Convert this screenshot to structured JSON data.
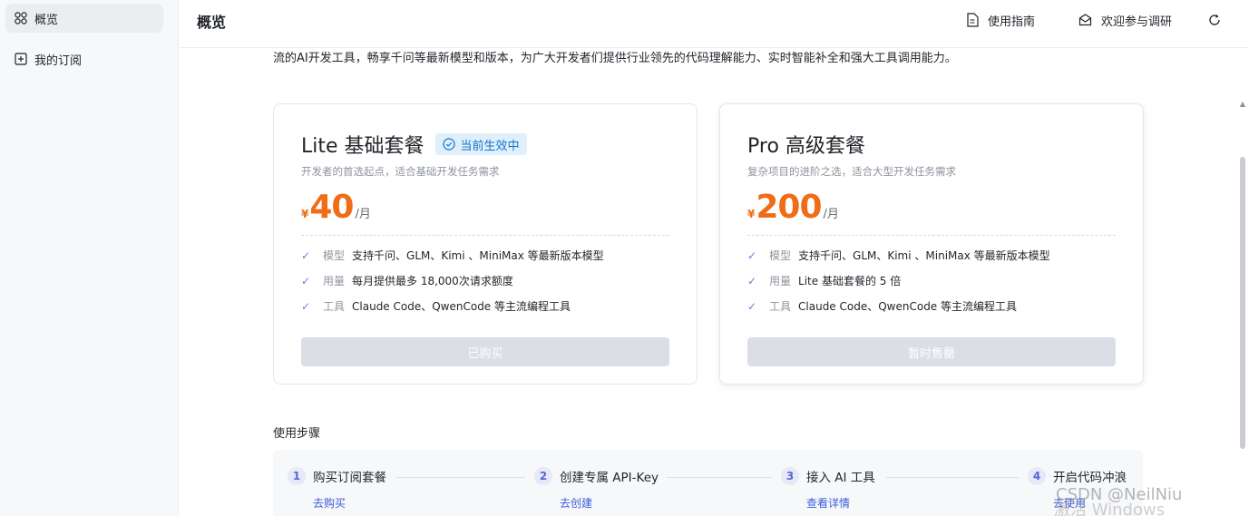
{
  "sidebar": {
    "items": [
      {
        "label": "概览",
        "icon": "grid-icon",
        "active": true
      },
      {
        "label": "我的订阅",
        "icon": "plus-square-icon",
        "active": false
      }
    ]
  },
  "header": {
    "title": "概览",
    "guide_label": "使用指南",
    "survey_label": "欢迎参与调研",
    "refresh_icon": "refresh-icon"
  },
  "intro": "流的AI开发工具，畅享千问等最新模型和版本，为广大开发者们提供行业领先的代码理解能力、实时智能补全和强大工具调用能力。",
  "plans": [
    {
      "title": "Lite 基础套餐",
      "badge": "当前生效中",
      "subtitle": "开发者的首选起点，适合基础开发任务需求",
      "currency": "¥",
      "price": "40",
      "unit": "/月",
      "features": [
        {
          "key": "模型",
          "value": "支持千问、GLM、Kimi 、MiniMax 等最新版本模型"
        },
        {
          "key": "用量",
          "value": "每月提供最多 18,000次请求额度"
        },
        {
          "key": "工具",
          "value": "Claude Code、QwenCode 等主流编程工具"
        }
      ],
      "button": "已购买"
    },
    {
      "title": "Pro 高级套餐",
      "badge": "",
      "subtitle": "复杂项目的进阶之选，适合大型开发任务需求",
      "currency": "¥",
      "price": "200",
      "unit": "/月",
      "features": [
        {
          "key": "模型",
          "value": "支持千问、GLM、Kimi 、MiniMax 等最新版本模型"
        },
        {
          "key": "用量",
          "value": "Lite 基础套餐的 5 倍"
        },
        {
          "key": "工具",
          "value": "Claude Code、QwenCode 等主流编程工具"
        }
      ],
      "button": "暂时售罄"
    }
  ],
  "steps": {
    "title": "使用步骤",
    "items": [
      {
        "num": "1",
        "label": "购买订阅套餐",
        "link": "去购买"
      },
      {
        "num": "2",
        "label": "创建专属 API-Key",
        "link": "去创建"
      },
      {
        "num": "3",
        "label": "接入 AI 工具",
        "link": "查看详情"
      },
      {
        "num": "4",
        "label": "开启代码冲浪",
        "link": "去使用"
      }
    ]
  },
  "watermark": {
    "csdn": "CSDN @NeilNiu",
    "windows": "激活 Windows"
  },
  "colors": {
    "accent_price": "#f06c16",
    "badge_bg": "#dff0fb",
    "badge_text": "#1672c9",
    "link": "#3b5bdb",
    "disabled_button": "#dcdee6"
  }
}
